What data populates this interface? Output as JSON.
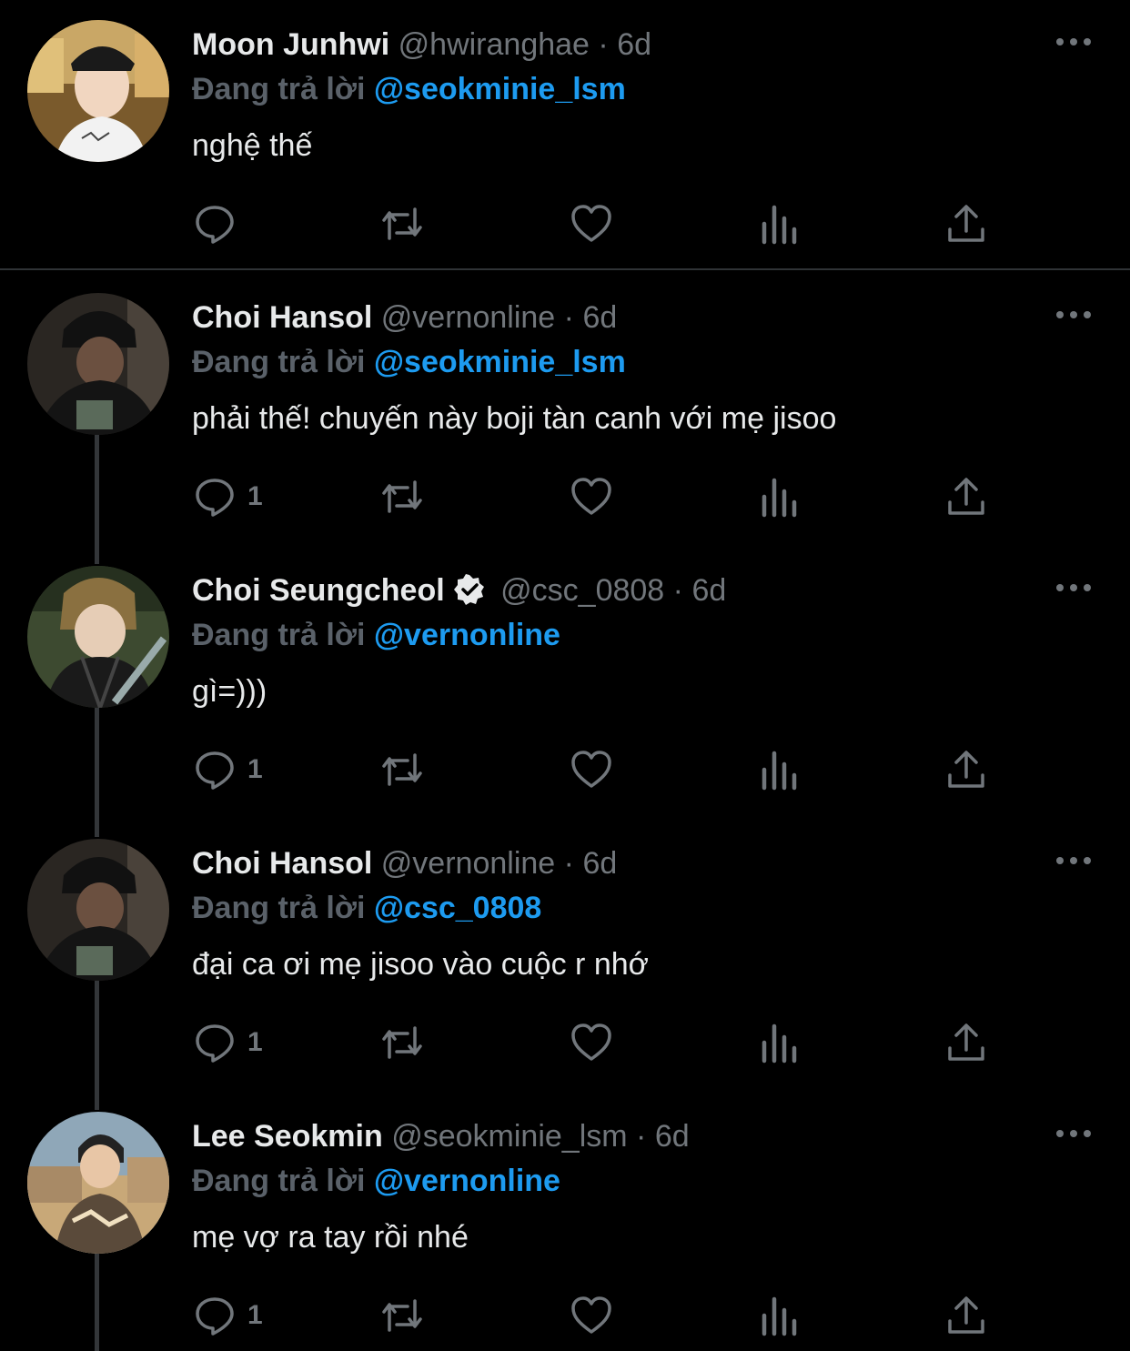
{
  "reply_prefix": "Đang trả lời",
  "separator": "·",
  "colors": {
    "background": "#000000",
    "accent": "#1d9bf0",
    "muted": "#71767b",
    "text": "#e7e9ea"
  },
  "action_icons": [
    "reply-icon",
    "retweet-icon",
    "like-icon",
    "analytics-icon",
    "share-icon"
  ],
  "tweets": [
    {
      "name": "Moon Junhwi",
      "handle": "@hwiranghae",
      "time": "6d",
      "verified": false,
      "reply_to": "@seokminie_lsm",
      "text": "nghệ thế",
      "reply_count": ""
    },
    {
      "name": "Choi Hansol",
      "handle": "@vernonline",
      "time": "6d",
      "verified": false,
      "reply_to": "@seokminie_lsm",
      "text": "phải thế! chuyến này boji tàn canh với mẹ jisoo",
      "reply_count": "1"
    },
    {
      "name": "Choi Seungcheol",
      "handle": "@csc_0808",
      "time": "6d",
      "verified": true,
      "reply_to": "@vernonline",
      "text": "gì=)))",
      "reply_count": "1"
    },
    {
      "name": "Choi Hansol",
      "handle": "@vernonline",
      "time": "6d",
      "verified": false,
      "reply_to": "@csc_0808",
      "text": "đại ca ơi mẹ jisoo vào cuộc r nhớ",
      "reply_count": "1"
    },
    {
      "name": "Lee Seokmin",
      "handle": "@seokminie_lsm",
      "time": "6d",
      "verified": false,
      "reply_to": "@vernonline",
      "text": "mẹ vợ ra tay rồi nhé",
      "reply_count": "1"
    }
  ]
}
